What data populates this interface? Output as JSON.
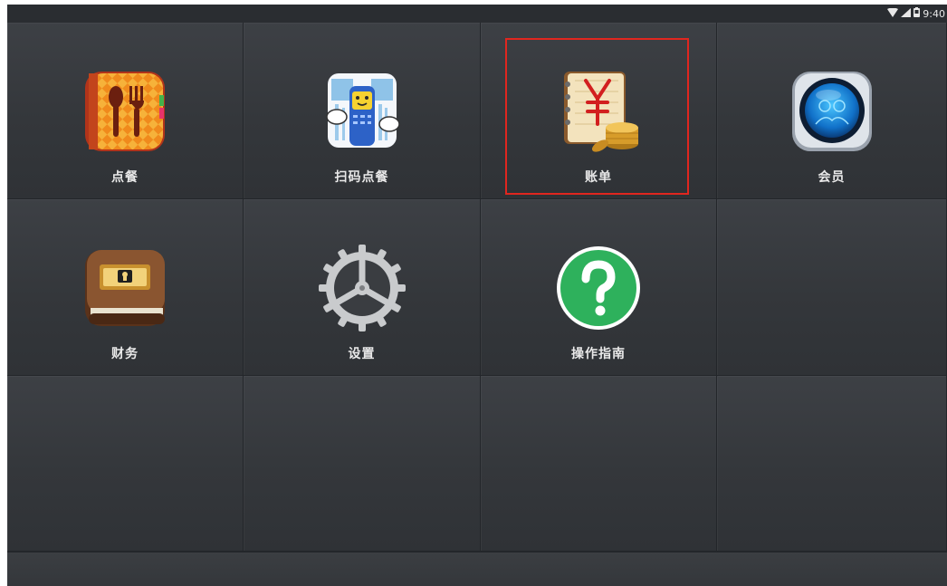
{
  "status_bar": {
    "time": "9:40",
    "icons": [
      "wifi-icon",
      "signal-icon",
      "battery-icon"
    ]
  },
  "tiles": [
    {
      "label": "点餐",
      "icon": "menu-book-icon"
    },
    {
      "label": "扫码点餐",
      "icon": "qr-scan-phone-icon"
    },
    {
      "label": "账单",
      "icon": "bill-yuan-coins-icon",
      "highlighted": true
    },
    {
      "label": "会员",
      "icon": "member-globe-icon"
    },
    {
      "label": "财务",
      "icon": "wallet-finance-icon"
    },
    {
      "label": "设置",
      "icon": "gear-icon"
    },
    {
      "label": "操作指南",
      "icon": "help-question-icon"
    }
  ],
  "colors": {
    "background": "#2c2f33",
    "highlight_border": "#e0261f",
    "label_text": "#e9e9e9",
    "help_green": "#2eb15c"
  }
}
